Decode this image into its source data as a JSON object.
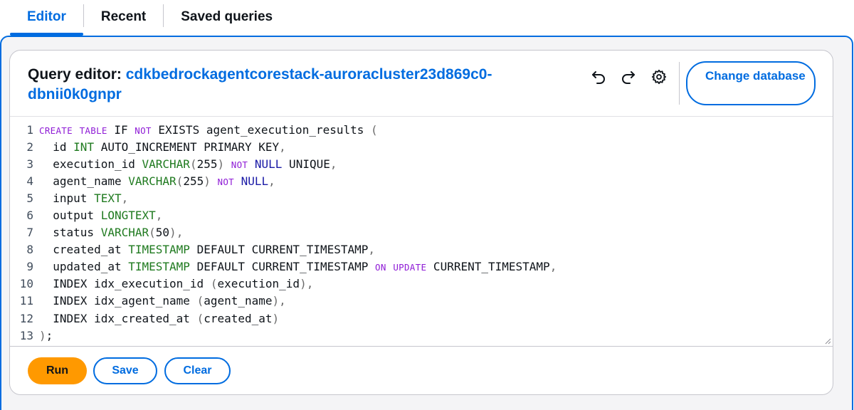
{
  "tabs": [
    {
      "label": "Editor",
      "active": true
    },
    {
      "label": "Recent",
      "active": false
    },
    {
      "label": "Saved queries",
      "active": false
    }
  ],
  "editor": {
    "title_label": "Query editor:",
    "database_name": "cdkbedrockagentcorestack-auroracluster23d869c0-dbnii0k0gnpr",
    "change_database_label": "Change database",
    "icons": [
      "undo-icon",
      "redo-icon",
      "settings-gear-icon"
    ]
  },
  "code": {
    "line_numbers": [
      "1",
      "2",
      "3",
      "4",
      "5",
      "6",
      "7",
      "8",
      "9",
      "10",
      "11",
      "12",
      "13"
    ],
    "lines": [
      "CREATE TABLE IF NOT EXISTS agent_execution_results (",
      "  id INT AUTO_INCREMENT PRIMARY KEY,",
      "  execution_id VARCHAR(255) NOT NULL UNIQUE,",
      "  agent_name VARCHAR(255) NOT NULL,",
      "  input TEXT,",
      "  output LONGTEXT,",
      "  status VARCHAR(50),",
      "  created_at TIMESTAMP DEFAULT CURRENT_TIMESTAMP,",
      "  updated_at TIMESTAMP DEFAULT CURRENT_TIMESTAMP ON UPDATE CURRENT_TIMESTAMP,",
      "  INDEX idx_execution_id (execution_id),",
      "  INDEX idx_agent_name (agent_name),",
      "  INDEX idx_created_at (created_at)",
      ");"
    ]
  },
  "footer": {
    "run_label": "Run",
    "save_label": "Save",
    "clear_label": "Clear"
  },
  "colors": {
    "accent": "#006ce0",
    "run_button": "#ff9900",
    "keyword": "#8f1cd6",
    "type": "#1f7a1f"
  }
}
